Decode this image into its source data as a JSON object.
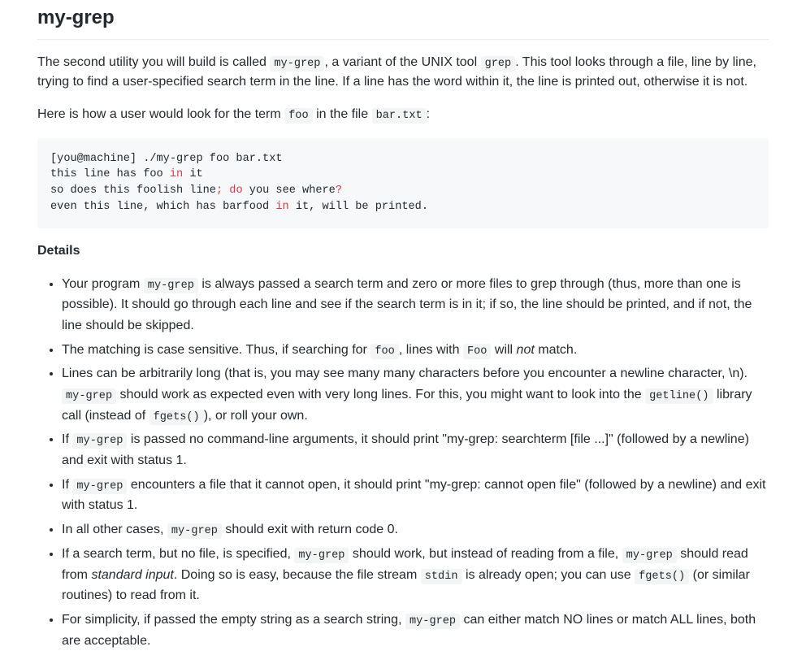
{
  "title": "my-grep",
  "intro1_parts": [
    {
      "t": "text",
      "v": "The second utility you will build is called "
    },
    {
      "t": "code",
      "v": "my-grep"
    },
    {
      "t": "text",
      "v": ", a variant of the UNIX tool "
    },
    {
      "t": "code",
      "v": "grep"
    },
    {
      "t": "text",
      "v": ". This tool looks through a file, line by line, trying to find a user-specified search term in the line. If a line has the word within it, the line is printed out, otherwise it is not."
    }
  ],
  "intro2_parts": [
    {
      "t": "text",
      "v": "Here is how a user would look for the term "
    },
    {
      "t": "code",
      "v": "foo"
    },
    {
      "t": "text",
      "v": " in the file "
    },
    {
      "t": "code",
      "v": "bar.txt"
    },
    {
      "t": "text",
      "v": ":"
    }
  ],
  "codeblock": [
    [
      {
        "t": "text",
        "v": "[you@machine] ./my-grep foo bar.txt"
      }
    ],
    [
      {
        "t": "text",
        "v": "this line has foo "
      },
      {
        "t": "kw",
        "v": "in"
      },
      {
        "t": "text",
        "v": " it"
      }
    ],
    [
      {
        "t": "text",
        "v": "so does this foolish line"
      },
      {
        "t": "kw",
        "v": ";"
      },
      {
        "t": "text",
        "v": " "
      },
      {
        "t": "kw",
        "v": "do"
      },
      {
        "t": "text",
        "v": " you see where"
      },
      {
        "t": "kw",
        "v": "?"
      }
    ],
    [
      {
        "t": "text",
        "v": "even this line, which has barfood "
      },
      {
        "t": "kw",
        "v": "in"
      },
      {
        "t": "text",
        "v": " it, will be printed."
      }
    ]
  ],
  "details_heading": "Details",
  "details": [
    [
      {
        "t": "text",
        "v": "Your program "
      },
      {
        "t": "code",
        "v": "my-grep"
      },
      {
        "t": "text",
        "v": " is always passed a search term and zero or more files to grep through (thus, more than one is possible). It should go through each line and see if the search term is in it; if so, the line should be printed, and if not, the line should be skipped."
      }
    ],
    [
      {
        "t": "text",
        "v": "The matching is case sensitive. Thus, if searching for "
      },
      {
        "t": "code",
        "v": "foo"
      },
      {
        "t": "text",
        "v": ", lines with "
      },
      {
        "t": "code",
        "v": "Foo"
      },
      {
        "t": "text",
        "v": " will "
      },
      {
        "t": "em",
        "v": "not"
      },
      {
        "t": "text",
        "v": " match."
      }
    ],
    [
      {
        "t": "text",
        "v": "Lines can be arbitrarily long (that is, you may see many many characters before you encounter a newline character, \\n). "
      },
      {
        "t": "code",
        "v": "my-grep"
      },
      {
        "t": "text",
        "v": " should work as expected even with very long lines. For this, you might want to look into the "
      },
      {
        "t": "code",
        "v": "getline()"
      },
      {
        "t": "text",
        "v": " library call (instead of "
      },
      {
        "t": "code",
        "v": "fgets()"
      },
      {
        "t": "text",
        "v": "), or roll your own."
      }
    ],
    [
      {
        "t": "text",
        "v": "If "
      },
      {
        "t": "code",
        "v": "my-grep"
      },
      {
        "t": "text",
        "v": " is passed no command-line arguments, it should print \"my-grep: searchterm [file ...]\" (followed by a newline) and exit with status 1."
      }
    ],
    [
      {
        "t": "text",
        "v": "If "
      },
      {
        "t": "code",
        "v": "my-grep"
      },
      {
        "t": "text",
        "v": " encounters a file that it cannot open, it should print \"my-grep: cannot open file\" (followed by a newline) and exit with status 1."
      }
    ],
    [
      {
        "t": "text",
        "v": "In all other cases, "
      },
      {
        "t": "code",
        "v": "my-grep"
      },
      {
        "t": "text",
        "v": " should exit with return code 0."
      }
    ],
    [
      {
        "t": "text",
        "v": "If a search term, but no file, is specified, "
      },
      {
        "t": "code",
        "v": "my-grep"
      },
      {
        "t": "text",
        "v": " should work, but instead of reading from a file, "
      },
      {
        "t": "code",
        "v": "my-grep"
      },
      {
        "t": "text",
        "v": " should read from "
      },
      {
        "t": "em",
        "v": "standard input"
      },
      {
        "t": "text",
        "v": ". Doing so is easy, because the file stream "
      },
      {
        "t": "code",
        "v": "stdin"
      },
      {
        "t": "text",
        "v": " is already open; you can use "
      },
      {
        "t": "code",
        "v": "fgets()"
      },
      {
        "t": "text",
        "v": " (or similar routines) to read from it."
      }
    ],
    [
      {
        "t": "text",
        "v": "For simplicity, if passed the empty string as a search string, "
      },
      {
        "t": "code",
        "v": "my-grep"
      },
      {
        "t": "text",
        "v": " can either match NO lines or match ALL lines, both are acceptable."
      }
    ]
  ]
}
